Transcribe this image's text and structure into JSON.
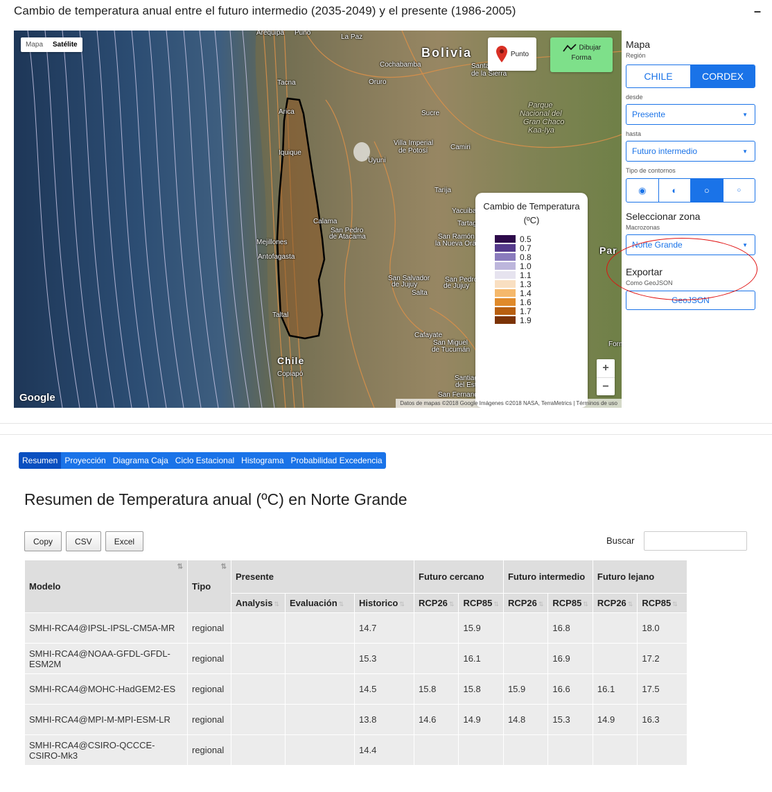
{
  "header": {
    "title": "Cambio de temperatura anual entre el futuro intermedio (2035-2049) y el presente (1986-2005)",
    "collapse": "–"
  },
  "map": {
    "type_options": [
      "Mapa",
      "Satélite"
    ],
    "active_type": "Satélite",
    "punto_label": "Punto",
    "dibujar_label_1": "Dibujar",
    "dibujar_label_2": "Forma",
    "google": "Google",
    "attribution": "Datos de mapas ©2018 Google Imágenes ©2018 NASA, TerraMetrics | Términos de uso",
    "zoom_in": "+",
    "zoom_out": "−",
    "places": {
      "arequipa": "Arequipa",
      "puno": "Puno",
      "lapaz": "La Paz",
      "bolivia": "Bolivia",
      "cochabamba": "Cochabamba",
      "santa_cruz": "Santa Cruz",
      "de_la_sierra": "de la Sierra",
      "tacna": "Tacna",
      "oruro": "Oruro",
      "arica": "Arica",
      "sucre": "Sucre",
      "parque1": "Parque",
      "parque2": "Nacional del",
      "parque3": "Gran Chaco",
      "parque4": "Kaa-Iya",
      "iquique": "Iquique",
      "villa1": "Villa Imperial",
      "villa2": "de Potosí",
      "uyuni": "Uyuni",
      "camiri": "Camiri",
      "tarija": "Tarija",
      "calama": "Calama",
      "sanpedro1": "San Pedro",
      "sanpedro2": "de Atacama",
      "yacuiba": "Yacuiba",
      "tartagal": "Tartagal",
      "mejillones": "Mejillones",
      "antofagasta": "Antofagasta",
      "sanramon1": "San Ramón",
      "sanramon2": "la Nueva Orán",
      "par": "Par",
      "sansalvador1": "San Salvador",
      "sansalvador2": "de Jujuy",
      "sanpedro_j1": "San Pedro",
      "sanpedro_j2": "de Jujuy",
      "salta": "Salta",
      "taltal": "Taltal",
      "cafayate": "Cafayate",
      "sanmiguel1": "San Miguel",
      "sanmiguel2": "de Tucumán",
      "chile": "Chile",
      "copiapo": "Copiapó",
      "formosa": "Form",
      "santiago1": "Santiago",
      "santiago2": "del Estero",
      "sanfernando": "San Fernando"
    },
    "legend": {
      "title": "Cambio de Temperatura (ºC)",
      "items": [
        {
          "label": "0.5",
          "color": "#2d0a4a"
        },
        {
          "label": "0.7",
          "color": "#553a8c"
        },
        {
          "label": "0.8",
          "color": "#8a7bbd"
        },
        {
          "label": "1.0",
          "color": "#bdb6dc"
        },
        {
          "label": "1.1",
          "color": "#e6e3ef"
        },
        {
          "label": "1.3",
          "color": "#f9dfc1"
        },
        {
          "label": "1.4",
          "color": "#f5b86b"
        },
        {
          "label": "1.6",
          "color": "#e08a2a"
        },
        {
          "label": "1.7",
          "color": "#b85f10"
        },
        {
          "label": "1.9",
          "color": "#7b3306"
        }
      ]
    }
  },
  "panel": {
    "mapa": "Mapa",
    "region_label": "Región",
    "region_options": [
      "CHILE",
      "CORDEX"
    ],
    "region_active": "CORDEX",
    "desde_label": "desde",
    "desde_value": "Presente",
    "hasta_label": "hasta",
    "hasta_value": "Futuro intermedio",
    "contornos_label": "Tipo de contornos",
    "contornos_options": [
      "◉",
      "◐",
      "○",
      "○"
    ],
    "seleccionar_zona": "Seleccionar zona",
    "macrozonas_label": "Macrozonas",
    "macrozona_value": "Norte Grande",
    "exportar": "Exportar",
    "como_geojson": "Como GeoJSON",
    "geojson_btn": "GeoJSON"
  },
  "tabs": [
    "Resumen",
    "Proyección",
    "Diagrama Caja",
    "Ciclo Estacional",
    "Histograma",
    "Probabilidad Excedencia"
  ],
  "active_tab": "Resumen",
  "section_title": "Resumen de Temperatura anual (ºC) en Norte Grande",
  "table_buttons": [
    "Copy",
    "CSV",
    "Excel"
  ],
  "search_label": "Buscar",
  "table": {
    "head_modelo": "Modelo",
    "head_tipo": "Tipo",
    "head_presente": "Presente",
    "head_cercano": "Futuro cercano",
    "head_intermedio": "Futuro intermedio",
    "head_lejano": "Futuro lejano",
    "sub": [
      "Analysis",
      "Evaluación",
      "Historico",
      "RCP26",
      "RCP85",
      "RCP26",
      "RCP85",
      "RCP26",
      "RCP85"
    ],
    "rows": [
      {
        "modelo": "SMHI-RCA4@IPSL-IPSL-CM5A-MR",
        "tipo": "regional",
        "analysis": "",
        "evaluacion": "",
        "historico": "14.7",
        "c26": "",
        "c85": "15.9",
        "i26": "",
        "i85": "16.8",
        "l26": "",
        "l85": "18.0"
      },
      {
        "modelo": "SMHI-RCA4@NOAA-GFDL-GFDL-ESM2M",
        "tipo": "regional",
        "analysis": "",
        "evaluacion": "",
        "historico": "15.3",
        "c26": "",
        "c85": "16.1",
        "i26": "",
        "i85": "16.9",
        "l26": "",
        "l85": "17.2"
      },
      {
        "modelo": "SMHI-RCA4@MOHC-HadGEM2-ES",
        "tipo": "regional",
        "analysis": "",
        "evaluacion": "",
        "historico": "14.5",
        "c26": "15.8",
        "c85": "15.8",
        "i26": "15.9",
        "i85": "16.6",
        "l26": "16.1",
        "l85": "17.5"
      },
      {
        "modelo": "SMHI-RCA4@MPI-M-MPI-ESM-LR",
        "tipo": "regional",
        "analysis": "",
        "evaluacion": "",
        "historico": "13.8",
        "c26": "14.6",
        "c85": "14.9",
        "i26": "14.8",
        "i85": "15.3",
        "l26": "14.9",
        "l85": "16.3"
      },
      {
        "modelo": "SMHI-RCA4@CSIRO-QCCCE-CSIRO-Mk3",
        "tipo": "regional",
        "analysis": "",
        "evaluacion": "",
        "historico": "14.4",
        "c26": "",
        "c85": "",
        "i26": "",
        "i85": "",
        "l26": "",
        "l85": ""
      }
    ]
  }
}
